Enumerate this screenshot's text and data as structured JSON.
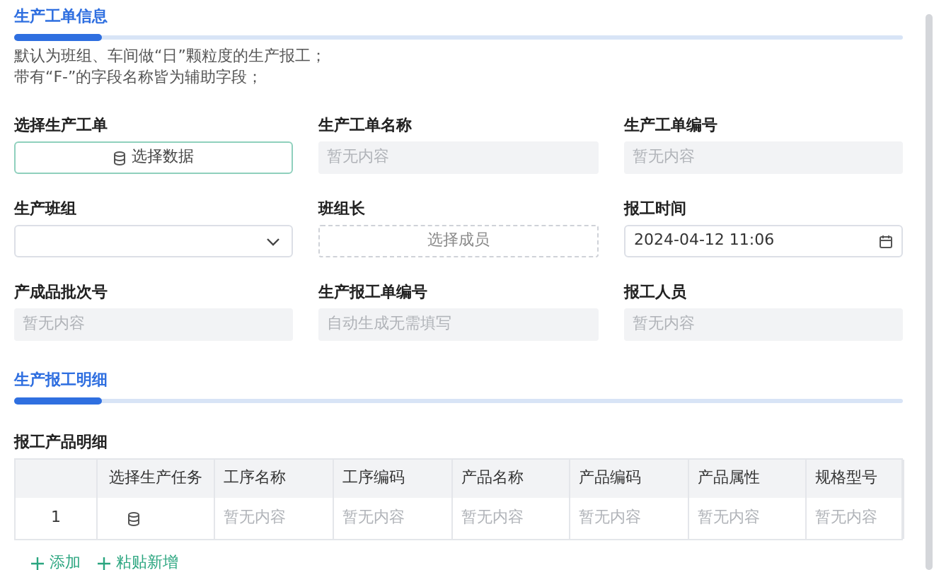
{
  "sections": [
    {
      "title": "生产工单信息",
      "notes": [
        "默认为班组、车间做“日”颗粒度的生产报工；",
        "带有“F-”的字段名称皆为辅助字段；"
      ],
      "fields": [
        {
          "label": "选择生产工单",
          "kind": "picker",
          "text": "选择数据"
        },
        {
          "label": "生产工单名称",
          "kind": "readonly",
          "placeholder": "暂无内容"
        },
        {
          "label": "生产工单编号",
          "kind": "readonly",
          "placeholder": "暂无内容"
        },
        {
          "label": "生产班组",
          "kind": "select"
        },
        {
          "label": "班组长",
          "kind": "member",
          "text": "选择成员"
        },
        {
          "label": "报工时间",
          "kind": "date",
          "value": "2024-04-12 11:06"
        },
        {
          "label": "产成品批次号",
          "kind": "readonly",
          "placeholder": "暂无内容"
        },
        {
          "label": "生产报工单编号",
          "kind": "readonly",
          "placeholder": "自动生成无需填写"
        },
        {
          "label": "报工人员",
          "kind": "readonly",
          "placeholder": "暂无内容"
        }
      ]
    },
    {
      "title": "生产报工明细"
    }
  ],
  "table": {
    "title": "报工产品明细",
    "columns": [
      "",
      "选择生产任务",
      "工序名称",
      "工序编码",
      "产品名称",
      "产品编码",
      "产品属性",
      "规格型号"
    ],
    "rows": [
      {
        "cells": [
          "1",
          "",
          "暂无内容",
          "暂无内容",
          "暂无内容",
          "暂无内容",
          "暂无内容",
          "暂无内容"
        ]
      }
    ]
  },
  "actions": [
    "添加",
    "粘贴新增"
  ]
}
